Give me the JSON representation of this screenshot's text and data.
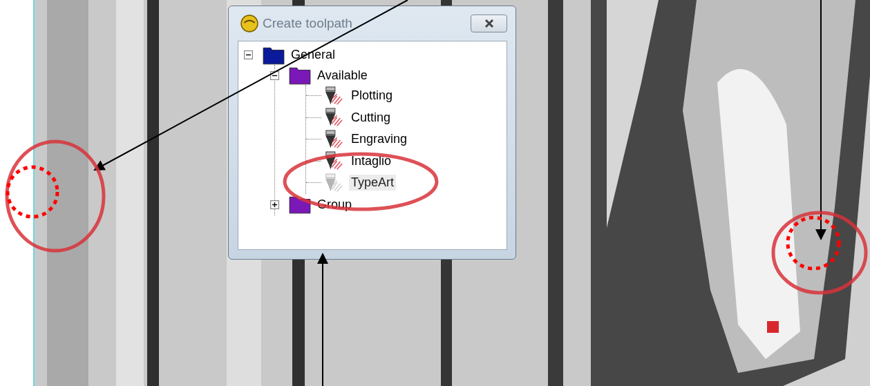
{
  "dialog": {
    "title": "Create toolpath",
    "tree": [
      {
        "label": "General",
        "kind": "folder",
        "color": "#0a1a9a",
        "expanded": true,
        "children": [
          {
            "label": "Available",
            "kind": "folder",
            "color": "#7a18b8",
            "expanded": true,
            "children": [
              {
                "label": "Plotting",
                "kind": "tool",
                "disabled": false,
                "selected": false
              },
              {
                "label": "Cutting",
                "kind": "tool",
                "disabled": false,
                "selected": false
              },
              {
                "label": "Engraving",
                "kind": "tool",
                "disabled": false,
                "selected": false
              },
              {
                "label": "Intaglio",
                "kind": "tool",
                "disabled": false,
                "selected": false
              },
              {
                "label": "TypeArt",
                "kind": "tool",
                "disabled": true,
                "selected": true
              }
            ]
          },
          {
            "label": "Group",
            "kind": "folder",
            "color": "#7a18b8",
            "expanded": false
          }
        ]
      }
    ]
  }
}
